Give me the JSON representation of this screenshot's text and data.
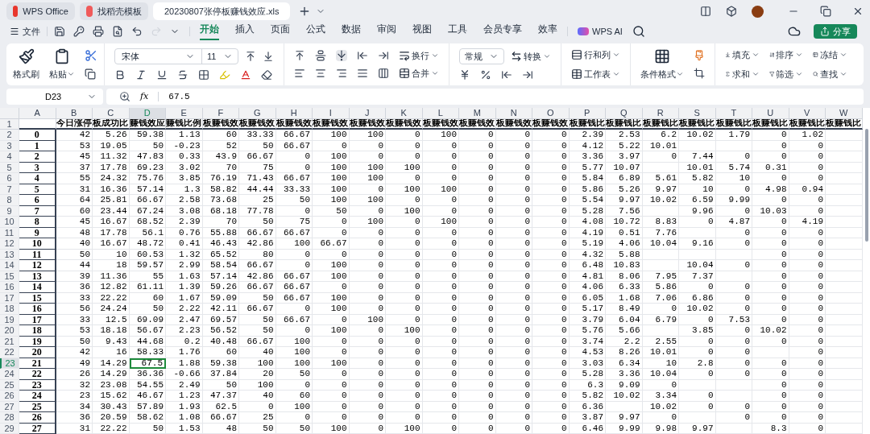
{
  "tabs": [
    {
      "label": "WPS Office",
      "kind": "home",
      "selected": false
    },
    {
      "label": "找稻壳模板",
      "kind": "template",
      "selected": false
    },
    {
      "label": "20230807张停板赚钱效应.xls",
      "kind": "document",
      "selected": true
    }
  ],
  "menu": {
    "file": "文件",
    "tabs": [
      {
        "label": "开始",
        "selected": true
      },
      {
        "label": "插入",
        "selected": false
      },
      {
        "label": "页面",
        "selected": false
      },
      {
        "label": "公式",
        "selected": false
      },
      {
        "label": "数据",
        "selected": false
      },
      {
        "label": "审阅",
        "selected": false
      },
      {
        "label": "视图",
        "selected": false
      },
      {
        "label": "工具",
        "selected": false
      },
      {
        "label": "会员专享",
        "selected": false
      },
      {
        "label": "效率",
        "selected": false
      }
    ],
    "ai": "WPS AI",
    "share": "分享"
  },
  "ribbon": {
    "format_painter": "格式刷",
    "paste": "粘贴",
    "font": "宋体",
    "size": "11",
    "wrap": "换行",
    "merge": "合并",
    "number_format": "常规",
    "convert": "转换",
    "rows_cols": "行和列",
    "worksheet": "工作表",
    "conditional": "条件格式",
    "fill": "填充",
    "sort": "排序",
    "freeze": "冻结",
    "sum": "求和",
    "filter": "筛选",
    "find": "查找"
  },
  "formula_bar": {
    "cell": "D23",
    "fx": "fx",
    "value": "67.5"
  },
  "columns": [
    {
      "letter": "A",
      "selected": false
    },
    {
      "letter": "B",
      "heading": "今日涨停",
      "selected": false
    },
    {
      "letter": "C",
      "heading": "板成功比",
      "selected": false
    },
    {
      "letter": "D",
      "heading": "赚钱效应",
      "selected": true
    },
    {
      "letter": "E",
      "heading": "赚钱比例",
      "selected": false
    },
    {
      "letter": "F",
      "heading": "板赚钱效",
      "selected": false
    },
    {
      "letter": "G",
      "heading": "板赚钱效",
      "selected": false
    },
    {
      "letter": "H",
      "heading": "板赚钱效",
      "selected": false
    },
    {
      "letter": "I",
      "heading": "板赚钱效",
      "selected": false
    },
    {
      "letter": "J",
      "heading": "板赚钱效",
      "selected": false
    },
    {
      "letter": "K",
      "heading": "板赚钱效",
      "selected": false
    },
    {
      "letter": "L",
      "heading": "板赚钱效",
      "selected": false
    },
    {
      "letter": "M",
      "heading": "板赚钱效",
      "selected": false
    },
    {
      "letter": "N",
      "heading": "板赚钱效",
      "selected": false
    },
    {
      "letter": "O",
      "heading": "板赚钱效",
      "selected": false
    },
    {
      "letter": "P",
      "heading": "板赚钱比",
      "selected": false
    },
    {
      "letter": "Q",
      "heading": "板赚钱比",
      "selected": false
    },
    {
      "letter": "R",
      "heading": "板赚钱比",
      "selected": false
    },
    {
      "letter": "S",
      "heading": "板赚钱比",
      "selected": false
    },
    {
      "letter": "T",
      "heading": "板赚钱比",
      "selected": false
    },
    {
      "letter": "U",
      "heading": "板赚钱比",
      "selected": false
    },
    {
      "letter": "V",
      "heading": "板赚钱比",
      "selected": false
    },
    {
      "letter": "W",
      "heading": "板赚钱比",
      "selected": false
    }
  ],
  "header_row": {
    "number": "1",
    "selected": false
  },
  "rows": [
    {
      "number": "2",
      "label": "0",
      "selected": false,
      "cells": [
        "42",
        "5.26",
        "59.38",
        "1.13",
        "60",
        "33.33",
        "66.67",
        "100",
        "100",
        "0",
        "100",
        "0",
        "0",
        "0",
        "2.39",
        "2.53",
        "6.2",
        "10.02",
        "1.79",
        "0",
        "1.02"
      ]
    },
    {
      "number": "3",
      "label": "1",
      "selected": false,
      "cells": [
        "53",
        "19.05",
        "50",
        "-0.23",
        "52",
        "50",
        "66.67",
        "0",
        "0",
        "0",
        "0",
        "0",
        "0",
        "0",
        "4.12",
        "5.22",
        "10.01",
        null,
        null,
        "0",
        "0"
      ]
    },
    {
      "number": "4",
      "label": "2",
      "selected": false,
      "cells": [
        "45",
        "11.32",
        "47.83",
        "0.33",
        "43.9",
        "66.67",
        "0",
        "100",
        "0",
        "0",
        "0",
        "0",
        "0",
        "0",
        "3.36",
        "3.97",
        "0",
        "7.44",
        "0",
        "0",
        "0"
      ]
    },
    {
      "number": "5",
      "label": "3",
      "selected": false,
      "cells": [
        "37",
        "17.78",
        "69.23",
        "3.02",
        "70",
        "75",
        "0",
        "100",
        "100",
        "100",
        "0",
        "0",
        "0",
        "0",
        "5.77",
        "10.07",
        null,
        "10.01",
        "5.74",
        "0.31",
        "0"
      ]
    },
    {
      "number": "6",
      "label": "4",
      "selected": false,
      "cells": [
        "55",
        "24.32",
        "75.76",
        "3.85",
        "76.19",
        "71.43",
        "66.67",
        "100",
        "100",
        "0",
        "0",
        "0",
        "0",
        "0",
        "5.84",
        "6.89",
        "5.61",
        "5.82",
        "10",
        "0",
        "0"
      ]
    },
    {
      "number": "7",
      "label": "5",
      "selected": false,
      "cells": [
        "31",
        "16.36",
        "57.14",
        "1.3",
        "58.82",
        "44.44",
        "33.33",
        "100",
        "0",
        "100",
        "100",
        "0",
        "0",
        "0",
        "5.86",
        "5.26",
        "9.97",
        "10",
        "0",
        "4.98",
        "0.94"
      ]
    },
    {
      "number": "8",
      "label": "6",
      "selected": false,
      "cells": [
        "64",
        "25.81",
        "66.67",
        "2.58",
        "73.68",
        "25",
        "50",
        "100",
        "100",
        "0",
        "0",
        "0",
        "0",
        "0",
        "5.54",
        "9.97",
        "10.02",
        "6.59",
        "9.99",
        "0",
        "0"
      ]
    },
    {
      "number": "9",
      "label": "7",
      "selected": false,
      "cells": [
        "60",
        "23.44",
        "67.24",
        "3.08",
        "68.18",
        "77.78",
        "0",
        "50",
        "0",
        "100",
        "0",
        "0",
        "0",
        "0",
        "5.28",
        "7.56",
        null,
        "9.96",
        "0",
        "10.03",
        "0"
      ]
    },
    {
      "number": "10",
      "label": "8",
      "selected": false,
      "cells": [
        "45",
        "16.67",
        "68.52",
        "2.39",
        "70",
        "50",
        "75",
        "0",
        "100",
        "0",
        "100",
        "0",
        "0",
        "0",
        "4.08",
        "10.72",
        "8.83",
        "0",
        "4.87",
        "0",
        "4.19"
      ]
    },
    {
      "number": "11",
      "label": "9",
      "selected": false,
      "cells": [
        "48",
        "17.78",
        "56.1",
        "0.76",
        "55.88",
        "66.67",
        "66.67",
        "0",
        "0",
        "0",
        "0",
        "0",
        "0",
        "0",
        "4.19",
        "0.51",
        "7.76",
        null,
        "0",
        "0",
        "0"
      ]
    },
    {
      "number": "12",
      "label": "10",
      "selected": false,
      "cells": [
        "40",
        "16.67",
        "48.72",
        "0.41",
        "46.43",
        "42.86",
        "100",
        "66.67",
        "0",
        "0",
        "0",
        "0",
        "0",
        "0",
        "5.19",
        "4.06",
        "10.04",
        "9.16",
        "0",
        "0",
        "0"
      ]
    },
    {
      "number": "13",
      "label": "11",
      "selected": false,
      "cells": [
        "50",
        "10",
        "60.53",
        "1.32",
        "65.52",
        "80",
        "0",
        "0",
        "0",
        "0",
        "0",
        "0",
        "0",
        "0",
        "4.32",
        "5.88",
        null,
        null,
        null,
        "0",
        "0"
      ]
    },
    {
      "number": "14",
      "label": "12",
      "selected": false,
      "cells": [
        "44",
        "18",
        "59.57",
        "2.99",
        "58.54",
        "66.67",
        "0",
        "100",
        "0",
        "0",
        "0",
        "0",
        "0",
        "0",
        "6.48",
        "10.83",
        null,
        "10.04",
        "0",
        "0",
        "0"
      ]
    },
    {
      "number": "15",
      "label": "13",
      "selected": false,
      "cells": [
        "39",
        "11.36",
        "55",
        "1.63",
        "57.14",
        "42.86",
        "66.67",
        "100",
        "0",
        "0",
        "0",
        "0",
        "0",
        "0",
        "4.81",
        "8.06",
        "7.95",
        "7.37",
        null,
        "0",
        "0"
      ]
    },
    {
      "number": "16",
      "label": "14",
      "selected": false,
      "cells": [
        "36",
        "12.82",
        "61.11",
        "1.39",
        "59.26",
        "66.67",
        "66.67",
        "0",
        "0",
        "0",
        "0",
        "0",
        "0",
        "0",
        "4.06",
        "6.33",
        "5.86",
        "0",
        "0",
        "0",
        "0"
      ]
    },
    {
      "number": "17",
      "label": "15",
      "selected": false,
      "cells": [
        "33",
        "22.22",
        "60",
        "1.67",
        "59.09",
        "50",
        "66.67",
        "100",
        "0",
        "0",
        "0",
        "0",
        "0",
        "0",
        "6.05",
        "1.68",
        "7.06",
        "6.86",
        "0",
        "0",
        "0"
      ]
    },
    {
      "number": "18",
      "label": "16",
      "selected": false,
      "cells": [
        "56",
        "24.24",
        "50",
        "2.22",
        "42.11",
        "66.67",
        "0",
        "100",
        "0",
        "0",
        "0",
        "0",
        "0",
        "0",
        "5.17",
        "8.49",
        "0",
        "10.02",
        "0",
        "0",
        "0"
      ]
    },
    {
      "number": "19",
      "label": "17",
      "selected": false,
      "cells": [
        "33",
        "12.5",
        "69.09",
        "2.47",
        "69.57",
        "50",
        "66.67",
        "0",
        "100",
        "0",
        "0",
        "0",
        "0",
        "0",
        "3.79",
        "6.04",
        "6.79",
        "0",
        "7.53",
        "0",
        "0"
      ]
    },
    {
      "number": "20",
      "label": "18",
      "selected": false,
      "cells": [
        "53",
        "18.18",
        "56.67",
        "2.23",
        "56.52",
        "50",
        "0",
        "100",
        "0",
        "100",
        "0",
        "0",
        "0",
        "0",
        "5.76",
        "5.66",
        null,
        "3.85",
        "0",
        "10.02",
        "0"
      ]
    },
    {
      "number": "21",
      "label": "19",
      "selected": false,
      "cells": [
        "50",
        "9.43",
        "44.68",
        "0.2",
        "40.48",
        "66.67",
        "100",
        "0",
        "0",
        "0",
        "0",
        "0",
        "0",
        "0",
        "3.74",
        "2.2",
        "2.55",
        "0",
        "0",
        "0",
        "0"
      ]
    },
    {
      "number": "22",
      "label": "20",
      "selected": false,
      "cells": [
        "42",
        "16",
        "58.33",
        "1.76",
        "60",
        "40",
        "100",
        "0",
        "0",
        "0",
        "0",
        "0",
        "0",
        "0",
        "4.53",
        "8.26",
        "10.01",
        "0",
        "0",
        null,
        "0"
      ]
    },
    {
      "number": "23",
      "label": "21",
      "selected": true,
      "cells": [
        "49",
        "14.29",
        "67.5",
        "1.88",
        "59.38",
        "100",
        "100",
        "100",
        "0",
        "0",
        "0",
        "0",
        "0",
        "0",
        "3.03",
        "6.34",
        "10",
        "2.8",
        "0",
        "0",
        "0"
      ]
    },
    {
      "number": "24",
      "label": "22",
      "selected": false,
      "cells": [
        "26",
        "14.29",
        "36.36",
        "-0.66",
        "37.84",
        "20",
        "50",
        "0",
        "0",
        "0",
        "0",
        "0",
        "0",
        "0",
        "5.28",
        "3.36",
        "10.04",
        "0",
        "0",
        "0",
        "0"
      ]
    },
    {
      "number": "25",
      "label": "23",
      "selected": false,
      "cells": [
        "32",
        "23.08",
        "54.55",
        "2.49",
        "50",
        "100",
        "0",
        "0",
        "0",
        "0",
        "0",
        "0",
        "0",
        "0",
        "6.3",
        "9.09",
        "0",
        null,
        null,
        "0",
        "0"
      ]
    },
    {
      "number": "26",
      "label": "24",
      "selected": false,
      "cells": [
        "23",
        "15.62",
        "46.67",
        "1.23",
        "47.37",
        "40",
        "60",
        "0",
        "0",
        "0",
        "0",
        "0",
        "0",
        "0",
        "5.82",
        "10.02",
        "3.34",
        "0",
        null,
        "0",
        "0"
      ]
    },
    {
      "number": "27",
      "label": "25",
      "selected": false,
      "cells": [
        "34",
        "30.43",
        "57.89",
        "1.93",
        "62.5",
        "0",
        "100",
        "0",
        "0",
        "0",
        "0",
        "0",
        "0",
        "0",
        "6.36",
        null,
        "10.02",
        "0",
        "0",
        "0",
        "0"
      ]
    },
    {
      "number": "28",
      "label": "26",
      "selected": false,
      "cells": [
        "36",
        "20.59",
        "58.62",
        "1.08",
        "66.67",
        "25",
        "0",
        "0",
        "0",
        "0",
        "0",
        "0",
        "0",
        "0",
        "3.87",
        "9.97",
        "0",
        null,
        "0",
        "0",
        "0"
      ]
    },
    {
      "number": "29",
      "label": "27",
      "selected": false,
      "cells": [
        "31",
        "22.22",
        "50",
        "1.53",
        "48",
        "50",
        "50",
        "100",
        "0",
        "100",
        "0",
        "0",
        "0",
        "0",
        "6.46",
        "9.99",
        "9.98",
        "9.97",
        null,
        "8.3",
        "0"
      ]
    }
  ]
}
